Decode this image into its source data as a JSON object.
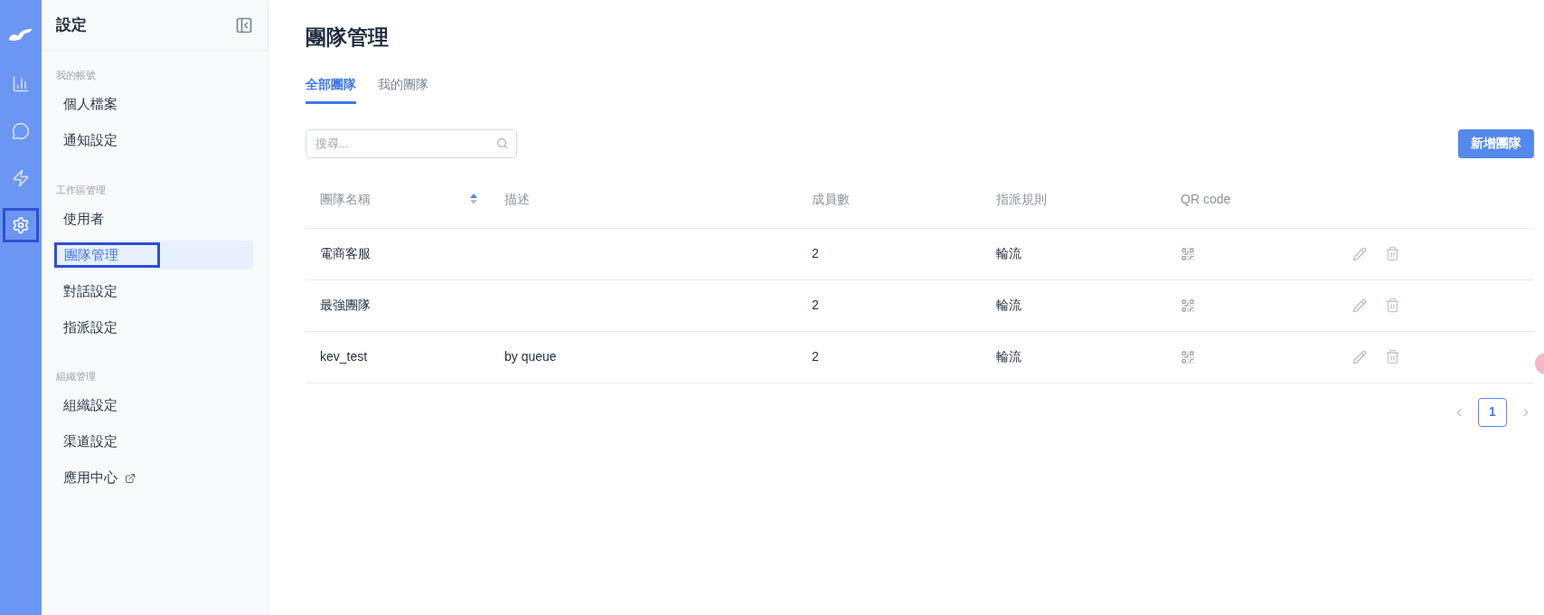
{
  "rail": {
    "items": [
      {
        "kind": "chart",
        "selected": false,
        "outlined": false
      },
      {
        "kind": "chat",
        "selected": false,
        "outlined": false
      },
      {
        "kind": "bolt",
        "selected": false,
        "outlined": false
      },
      {
        "kind": "gear",
        "selected": true,
        "outlined": true
      }
    ]
  },
  "sidebar": {
    "title": "設定",
    "sections": [
      {
        "heading": "我的帳號",
        "items": [
          {
            "label": "個人檔案",
            "selected": false,
            "outlined": false,
            "external": false
          },
          {
            "label": "通知設定",
            "selected": false,
            "outlined": false,
            "external": false
          }
        ]
      },
      {
        "heading": "工作區管理",
        "items": [
          {
            "label": "使用者",
            "selected": false,
            "outlined": false,
            "external": false
          },
          {
            "label": "團隊管理",
            "selected": true,
            "outlined": true,
            "external": false
          },
          {
            "label": "對話設定",
            "selected": false,
            "outlined": false,
            "external": false
          },
          {
            "label": "指派設定",
            "selected": false,
            "outlined": false,
            "external": false
          }
        ]
      },
      {
        "heading": "組織管理",
        "items": [
          {
            "label": "組織設定",
            "selected": false,
            "outlined": false,
            "external": false
          },
          {
            "label": "渠道設定",
            "selected": false,
            "outlined": false,
            "external": false
          },
          {
            "label": "應用中心",
            "selected": false,
            "outlined": false,
            "external": true
          }
        ]
      }
    ]
  },
  "page": {
    "title": "團隊管理",
    "tabs": [
      {
        "label": "全部團隊",
        "selected": true
      },
      {
        "label": "我的團隊",
        "selected": false
      }
    ],
    "search": {
      "placeholder": "搜尋..."
    },
    "add_button": "新增團隊",
    "table": {
      "columns": [
        "團隊名稱",
        "描述",
        "成員數",
        "指派規則",
        "QR code"
      ],
      "rows": [
        {
          "name": "電商客服",
          "description": "",
          "members": "2",
          "rule": "輪流"
        },
        {
          "name": "最強團隊",
          "description": "",
          "members": "2",
          "rule": "輪流"
        },
        {
          "name": "kev_test",
          "description": "by queue",
          "members": "2",
          "rule": "輪流"
        }
      ]
    },
    "pagination": {
      "pages": [
        {
          "label": "1",
          "selected": true
        }
      ]
    }
  }
}
